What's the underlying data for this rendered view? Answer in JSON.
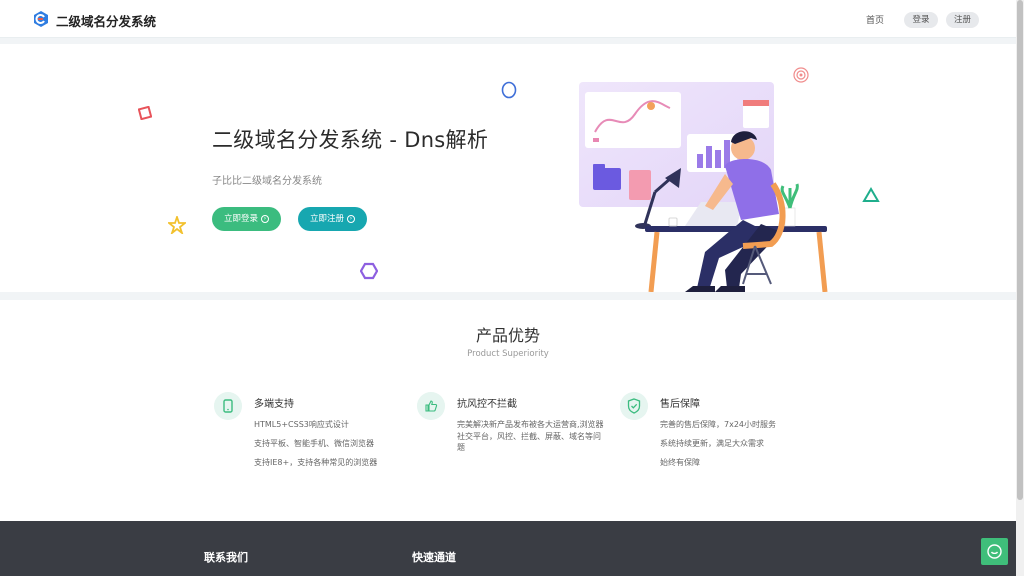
{
  "header": {
    "site_title": "二级域名分发系统",
    "nav_home": "首页",
    "nav_login": "登录",
    "nav_register": "注册"
  },
  "hero": {
    "title": "二级域名分发系统 - Dns解析",
    "subtitle": "子比比二级域名分发系统",
    "login_btn": "立即登录",
    "register_btn": "立即注册"
  },
  "features": {
    "title": "产品优势",
    "subtitle": "Product Superiority",
    "items": [
      {
        "name": "多端支持",
        "lines": [
          "HTML5+CSS3响应式设计",
          "支持平板、智能手机、微信浏览器",
          "支持IE8+，支持各种常见的浏览器"
        ]
      },
      {
        "name": "抗风控不拦截",
        "text": "完美解决新产品发布被各大运营商,浏览器社交平台，风控、拦截、屏蔽、域名等问题"
      },
      {
        "name": "售后保障",
        "lines": [
          "完善的售后保障，7x24小时服务",
          "系统持续更新，满足大众需求",
          "始终有保障"
        ]
      }
    ]
  },
  "footer": {
    "contact": "联系我们",
    "quick": "快速通道"
  },
  "colors": {
    "green": "#3bbc7f",
    "teal": "#17a7b0",
    "footer_bg": "#3a3d44"
  },
  "icons": [
    "logo-icon",
    "arrow-circle-icon",
    "tablet-icon",
    "thumbs-up-icon",
    "shield-check-icon",
    "chat-icon"
  ]
}
